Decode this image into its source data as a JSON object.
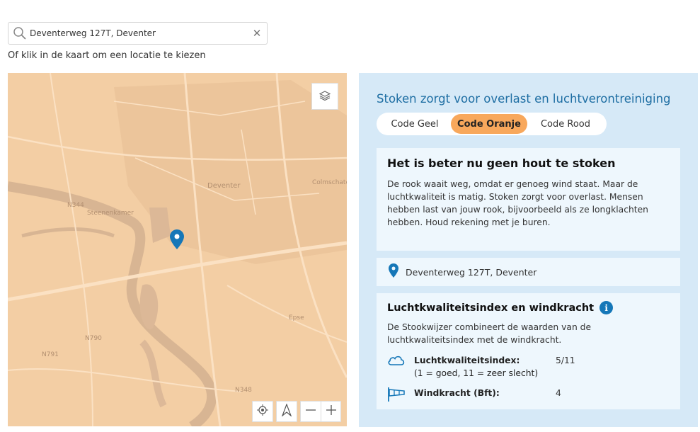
{
  "search": {
    "value": "Deventerweg 127T, Deventer",
    "clear_icon": "close-icon",
    "search_icon": "search-icon"
  },
  "hint": "Of klik in de kaart om een locatie te kiezen",
  "map": {
    "labels": {
      "deventer": "Deventer",
      "colmschate": "Colmschate",
      "steenenkamer": "Steenenkamer",
      "epse": "Epse",
      "n344": "N344",
      "n790": "N790",
      "n791": "N791",
      "n348": "N348"
    },
    "colors": {
      "land": "#f3cea4",
      "water": "#d9b79a",
      "road": "#fbe2c6"
    }
  },
  "panel": {
    "title": "Stoken zorgt voor overlast en luchtverontreiniging",
    "codes": [
      "Code Geel",
      "Code Oranje",
      "Code Rood"
    ],
    "active_code": "Code Oranje",
    "advice_title": "Het is beter nu geen hout te stoken",
    "advice_text": "De rook waait weg, omdat er genoeg wind staat. Maar de luchtkwaliteit is matig. Stoken zorgt voor overlast. Mensen hebben last van jouw rook, bijvoorbeeld als ze longklachten hebben. Houd rekening met je buren.",
    "address": "Deventerweg 127T, Deventer",
    "index_title": "Luchtkwaliteitsindex en windkracht",
    "index_text": "De Stookwijzer combineert de waarden van de luchtkwaliteitsindex met de windkracht.",
    "aqi_label": "Luchtkwaliteitsindex:",
    "aqi_sub": "(1 = goed, 11 = zeer slecht)",
    "aqi_value": "5/11",
    "wind_label": "Windkracht (Bft):",
    "wind_value": "4",
    "info_glyph": "i",
    "colors": {
      "accent": "#1e6ea3",
      "active_code": "#f8a85c",
      "panel_bg": "#d6e9f7"
    }
  }
}
